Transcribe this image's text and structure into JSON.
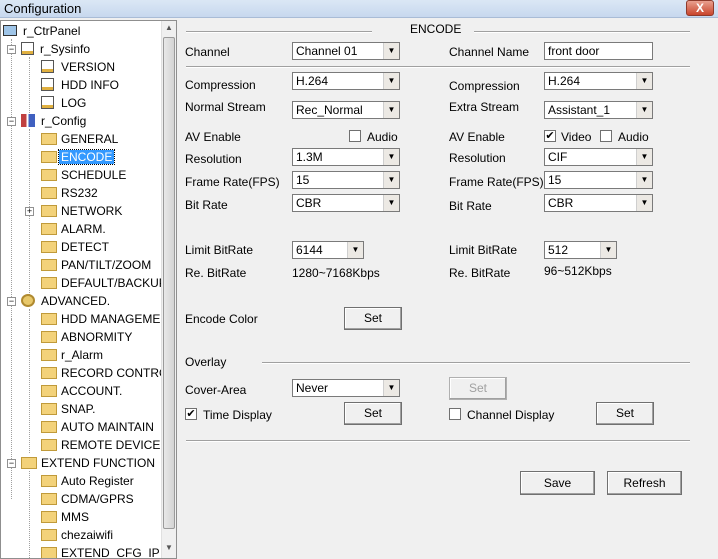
{
  "window": {
    "title": "Configuration",
    "close_label": "X"
  },
  "tree": {
    "items": [
      {
        "label": "r_CtrPanel"
      },
      {
        "label": "r_Sysinfo"
      },
      {
        "label": "VERSION"
      },
      {
        "label": "HDD INFO"
      },
      {
        "label": "LOG"
      },
      {
        "label": "r_Config"
      },
      {
        "label": "GENERAL"
      },
      {
        "label": "ENCODE"
      },
      {
        "label": "SCHEDULE"
      },
      {
        "label": "RS232"
      },
      {
        "label": "NETWORK"
      },
      {
        "label": "ALARM."
      },
      {
        "label": "DETECT"
      },
      {
        "label": "PAN/TILT/ZOOM"
      },
      {
        "label": "DEFAULT/BACKUP"
      },
      {
        "label": "ADVANCED."
      },
      {
        "label": "HDD MANAGEMENT"
      },
      {
        "label": "ABNORMITY"
      },
      {
        "label": "r_Alarm"
      },
      {
        "label": "RECORD CONTROL"
      },
      {
        "label": "ACCOUNT."
      },
      {
        "label": "SNAP."
      },
      {
        "label": "AUTO MAINTAIN"
      },
      {
        "label": "REMOTE DEVICE"
      },
      {
        "label": "EXTEND FUNCTION"
      },
      {
        "label": "Auto Register"
      },
      {
        "label": "CDMA/GPRS"
      },
      {
        "label": "MMS"
      },
      {
        "label": "chezaiwifi"
      },
      {
        "label": "EXTEND_CFG_IP_Filter"
      }
    ]
  },
  "encode": {
    "section_title": "ENCODE",
    "channel_label": "Channel",
    "channel_value": "Channel  01",
    "channel_name_label": "Channel Name",
    "channel_name_value": "front door",
    "main": {
      "compression_label": "Compression",
      "compression_value": "H.264",
      "stream_label": "Normal Stream",
      "stream_value": "Rec_Normal",
      "av_enable_label": "AV Enable",
      "audio_label": "Audio",
      "resolution_label": "Resolution",
      "resolution_value": "1.3M",
      "fps_label": "Frame Rate(FPS)",
      "fps_value": "15",
      "bitrate_label": "Bit Rate",
      "bitrate_value": "CBR",
      "limit_label": "Limit BitRate",
      "limit_value": "6144",
      "re_label": "Re. BitRate",
      "re_value": "1280~7168Kbps"
    },
    "extra": {
      "compression_label": "Compression",
      "compression_value": "H.264",
      "stream_label": "Extra Stream",
      "stream_value": "Assistant_1",
      "av_enable_label": "AV Enable",
      "video_label": "Video",
      "audio_label": "Audio",
      "resolution_label": "Resolution",
      "resolution_value": "CIF",
      "fps_label": "Frame Rate(FPS)",
      "fps_value": "15",
      "bitrate_label": "Bit Rate",
      "bitrate_value": "CBR",
      "limit_label": "Limit BitRate",
      "limit_value": "512",
      "re_label": "Re. BitRate",
      "re_value": "96~512Kbps"
    },
    "encode_color_label": "Encode Color",
    "set_label": "Set",
    "overlay_label": "Overlay",
    "cover_area_label": "Cover-Area",
    "cover_area_value": "Never",
    "time_display_label": "Time Display",
    "channel_display_label": "Channel Display",
    "save_label": "Save",
    "refresh_label": "Refresh"
  }
}
